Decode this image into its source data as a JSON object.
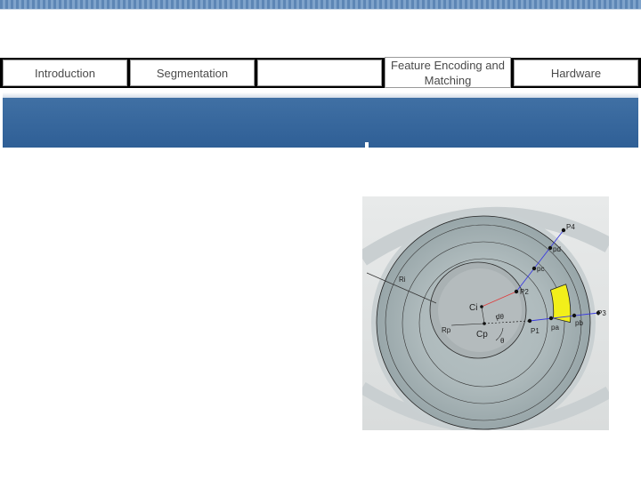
{
  "nav": {
    "tabs": [
      {
        "label": "Introduction"
      },
      {
        "label": "Segmentation"
      },
      {
        "label": ""
      },
      {
        "label": "Feature Encoding and Matching"
      },
      {
        "label": "Hardware"
      }
    ]
  },
  "diagram": {
    "labels": {
      "p4": "P4",
      "pd": "pd",
      "pc": "pc",
      "p2": "P2",
      "ri": "Ri",
      "ci": "Ci",
      "dtheta": "dθ",
      "rp": "Rp",
      "cp": "Cp",
      "theta": "θ",
      "p1": "P1",
      "pa": "pa",
      "pb": "pb",
      "p3": "P3"
    },
    "colors": {
      "sector": "#f2ef1a",
      "ray_to_p4": "#3a3ae0",
      "ray_from_ci": "#e03a3a"
    }
  }
}
